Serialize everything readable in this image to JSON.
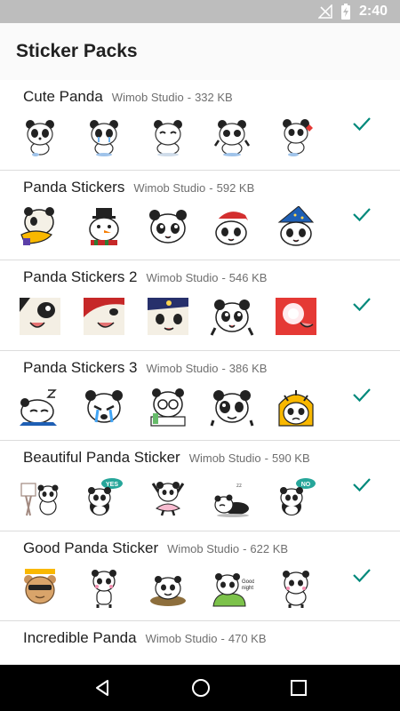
{
  "status_bar": {
    "time": "2:40",
    "icons": [
      "no-signal-icon",
      "battery-charging-icon"
    ]
  },
  "header": {
    "title": "Sticker Packs"
  },
  "colors": {
    "accent": "#00897b",
    "divider": "#dcdcdc",
    "meta_text": "#6f6f6f"
  },
  "packs": [
    {
      "name": "Cute Panda",
      "publisher": "Wimob Studio",
      "separator": "-",
      "size": "332 KB",
      "added": true
    },
    {
      "name": "Panda Stickers",
      "publisher": "Wimob Studio",
      "separator": "-",
      "size": "592 KB",
      "added": true
    },
    {
      "name": "Panda Stickers 2",
      "publisher": "Wimob Studio",
      "separator": "-",
      "size": "546 KB",
      "added": true
    },
    {
      "name": "Panda Stickers 3",
      "publisher": "Wimob Studio",
      "separator": "-",
      "size": "386 KB",
      "added": true
    },
    {
      "name": "Beautiful Panda Sticker",
      "publisher": "Wimob Studio",
      "separator": "-",
      "size": "590 KB",
      "added": true
    },
    {
      "name": "Good Panda Sticker",
      "publisher": "Wimob Studio",
      "separator": "-",
      "size": "622 KB",
      "added": true
    },
    {
      "name": "Incredible Panda",
      "publisher": "Wimob Studio",
      "separator": "-",
      "size": "470 KB",
      "added": false
    }
  ],
  "sticker_labels": {
    "yes": "YES",
    "no": "NO"
  },
  "nav": {
    "icons": [
      "back-icon",
      "home-icon",
      "recents-icon"
    ]
  }
}
